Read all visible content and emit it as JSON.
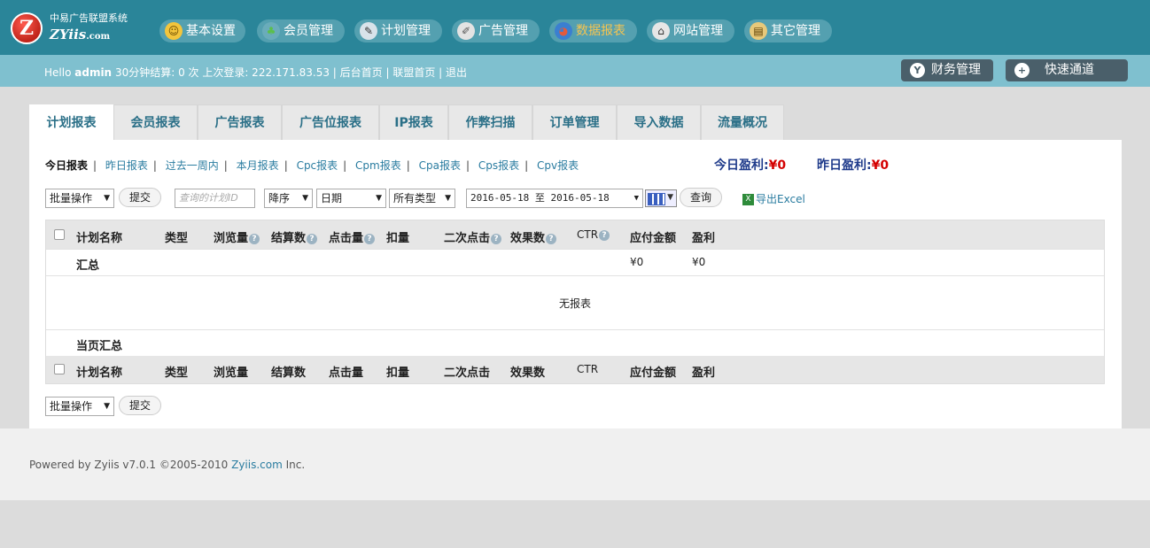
{
  "logo": {
    "letter": "Z",
    "cn": "中易广告联盟系统",
    "en": "ZYiis",
    "en_suffix": ".com"
  },
  "nav": [
    {
      "label": "基本设置",
      "icon": "user-icon",
      "glyph": "☺",
      "color": "#f3c53c"
    },
    {
      "label": "会员管理",
      "icon": "members-icon",
      "glyph": "♣",
      "color": "#5bbf4b"
    },
    {
      "label": "计划管理",
      "icon": "plan-icon",
      "glyph": "✎",
      "color": "#d9e3ea"
    },
    {
      "label": "广告管理",
      "icon": "ad-icon",
      "glyph": "✐",
      "color": "#e3e3e3"
    },
    {
      "label": "数据报表",
      "icon": "report-icon",
      "glyph": "◕",
      "color": "#e35a3c",
      "active": true
    },
    {
      "label": "网站管理",
      "icon": "site-icon",
      "glyph": "⌂",
      "color": "#e6e6e6"
    },
    {
      "label": "其它管理",
      "icon": "other-icon",
      "glyph": "▤",
      "color": "#e8c97a"
    }
  ],
  "status": {
    "hello": "Hello",
    "user": "admin",
    "rest": "30分钟结算: 0 次 上次登录: 222.171.83.53 | 后台首页 | 联盟首页 | 退出"
  },
  "quick": {
    "finance": "财务管理",
    "finance_icon": "Y",
    "shortcut": "快速通道",
    "shortcut_icon": "+"
  },
  "tabs": [
    "计划报表",
    "会员报表",
    "广告报表",
    "广告位报表",
    "IP报表",
    "作弊扫描",
    "订单管理",
    "导入数据",
    "流量概况"
  ],
  "sublinks": [
    "今日报表",
    "昨日报表",
    "过去一周内",
    "本月报表",
    "Cpc报表",
    "Cpm报表",
    "Cpa报表",
    "Cps报表",
    "Cpv报表"
  ],
  "profit": {
    "today_label": "今日盈利:",
    "today_value": "¥0",
    "yesterday_label": "昨日盈利:",
    "yesterday_value": "¥0"
  },
  "filters": {
    "batch": "批量操作",
    "submit": "提交",
    "search_placeholder": "查询的计划ID",
    "order": "降序",
    "date_field": "日期",
    "type": "所有类型",
    "date_range": "2016-05-18 至 2016-05-18",
    "query": "查询",
    "export": "导出Excel"
  },
  "table": {
    "headers": [
      "计划名称",
      "类型",
      "浏览量",
      "结算数",
      "点击量",
      "扣量",
      "二次点击",
      "效果数",
      "CTR",
      "应付金额",
      "盈利"
    ],
    "summary_label": "汇总",
    "summary_pay": "¥0",
    "summary_profit": "¥0",
    "empty": "无报表",
    "page_summary": "当页汇总"
  },
  "bottom": {
    "batch": "批量操作",
    "submit": "提交"
  },
  "footer": {
    "prefix": "Powered by Zyiis v7.0.1 ©2005-2010 ",
    "link": "Zyiis.com",
    "suffix": " Inc."
  }
}
